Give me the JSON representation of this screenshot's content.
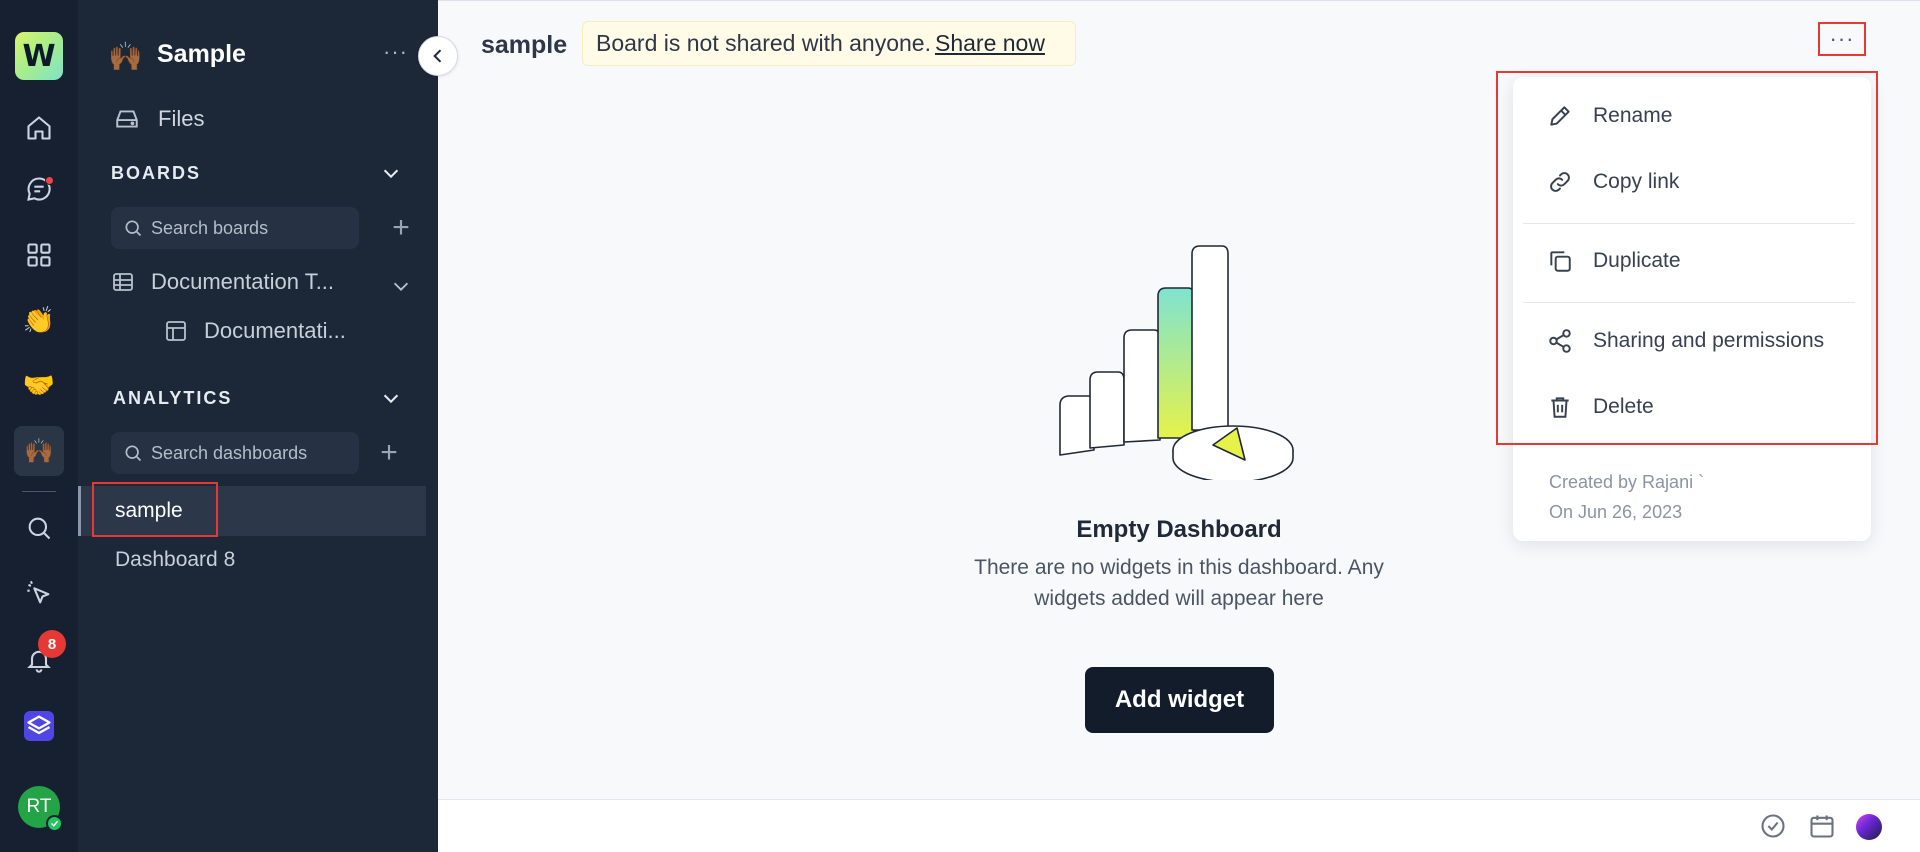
{
  "app": {
    "logo_letter": "W",
    "rail_items": [
      {
        "icon": "home-icon"
      },
      {
        "icon": "chat-icon"
      },
      {
        "icon": "apps-grid-icon"
      },
      {
        "icon": "clap-emoji-icon"
      },
      {
        "icon": "handshake-emoji-icon"
      },
      {
        "icon": "workspace-emoji-icon"
      },
      {
        "icon": "search-icon"
      },
      {
        "icon": "cursor-sparkle-icon"
      },
      {
        "icon": "bell-icon"
      },
      {
        "icon": "stack-icon"
      }
    ],
    "notification_count": "8",
    "avatar_initials": "RT"
  },
  "sidebar": {
    "workspace_emoji": "🙌🏾",
    "workspace_title": "Sample",
    "files_label": "Files",
    "boards_section": "BOARDS",
    "boards_search_placeholder": "Search boards",
    "board_name": "Documentation T...",
    "sub_board_name": "Documentati...",
    "analytics_section": "ANALYTICS",
    "dashboards_search_placeholder": "Search dashboards",
    "dashboards": [
      {
        "label": "sample",
        "active": true
      },
      {
        "label": "Dashboard 8",
        "active": false
      }
    ]
  },
  "header": {
    "title": "sample",
    "share_text": "Board is not shared with anyone.",
    "share_link": "Share now",
    "more_label": "···"
  },
  "empty_state": {
    "title": "Empty Dashboard",
    "description": "There are no widgets in this dashboard. Any widgets added will appear here",
    "button_label": "Add widget"
  },
  "menu": {
    "items": [
      {
        "label": "Rename",
        "icon": "pencil-icon"
      },
      {
        "label": "Copy link",
        "icon": "link-icon"
      },
      {
        "label": "Duplicate",
        "icon": "duplicate-icon"
      },
      {
        "label": "Sharing and permissions",
        "icon": "share-icon"
      },
      {
        "label": "Delete",
        "icon": "trash-icon"
      }
    ],
    "created_by": "Created by Rajani `",
    "created_on": "On Jun 26, 2023"
  },
  "colors": {
    "rail_bg": "#162030",
    "sidebar_bg": "#1c2737",
    "highlight_red": "#e53935",
    "primary_button": "#131c2b",
    "banner_bg": "#fffbe6"
  }
}
